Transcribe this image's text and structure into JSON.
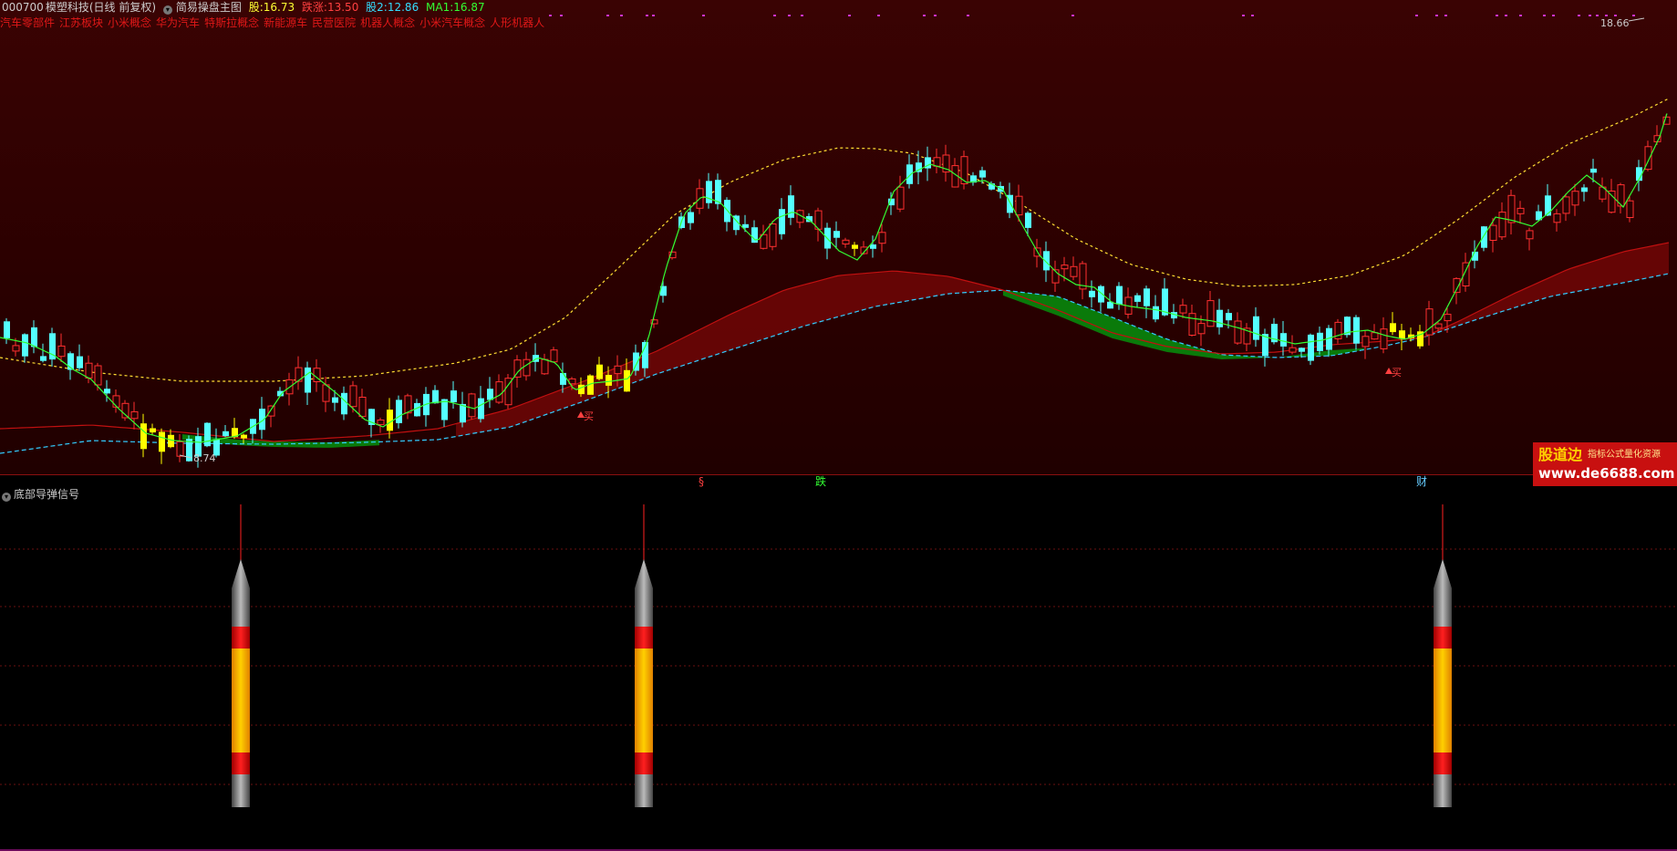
{
  "header": {
    "code": "000700",
    "name": "模塑科技",
    "period": "(日线 前复权)",
    "indicator": "简易操盘主图",
    "fields": [
      {
        "label": "股:",
        "value": "16.73",
        "color": "#ffff33"
      },
      {
        "label": "跌涨:",
        "value": "13.50",
        "color": "#ff4040"
      },
      {
        "label": "股2:",
        "value": "12.86",
        "color": "#33ddff"
      },
      {
        "label": "MA1:",
        "value": "16.87",
        "color": "#33ff33"
      }
    ]
  },
  "concepts": [
    "汽车零部件",
    "江苏板块",
    "小米概念",
    "华为汽车",
    "特斯拉概念",
    "新能源车",
    "民营医院",
    "机器人概念",
    "小米汽车概念",
    "人形机器人"
  ],
  "price_labels": {
    "low": "8.74",
    "high": "18.66"
  },
  "chart_annotations": {
    "buy": "买"
  },
  "markers": [
    {
      "text": "§",
      "color": "#ff4040"
    },
    {
      "text": "跌",
      "color": "#33ff33"
    },
    {
      "text": "财",
      "color": "#66ccff"
    }
  ],
  "sub_indicator": {
    "title": "底部导弹信号"
  },
  "watermark": {
    "main": "股道边",
    "sub": "指标公式量化资源",
    "url": "www.de6688.com"
  },
  "colors": {
    "up": "#ff3030",
    "down": "#54ffff",
    "buy": "#ffff00",
    "ma_short": "#33ff33",
    "ma_dotted": "#ffdd33",
    "ma_long": "#33ccff",
    "band": "#a01010",
    "bear_band": "#0a7a0a"
  }
}
